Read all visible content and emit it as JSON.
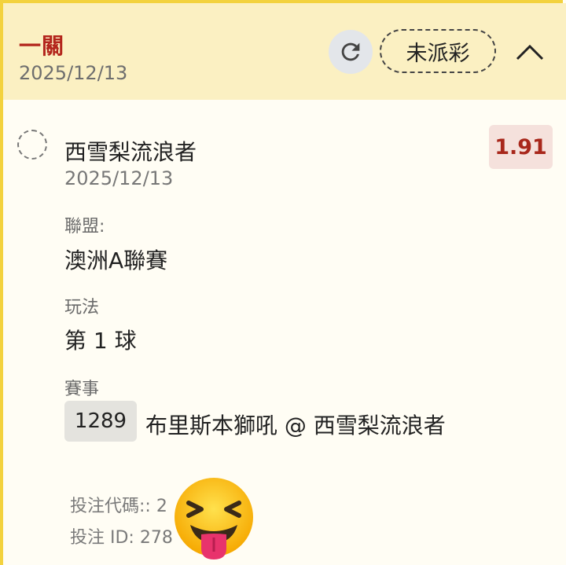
{
  "header": {
    "title": "一關",
    "date": "2025/12/13",
    "status_label": "未派彩"
  },
  "selection": {
    "team": "西雪梨流浪者",
    "odds": "1.91",
    "date": "2025/12/13",
    "league_label": "聯盟:",
    "league_value": "澳洲A聯賽",
    "play_label": "玩法",
    "play_value": "第 1 球",
    "match_label": "賽事",
    "match_id": "1289",
    "match_name": "布里斯本獅吼 @ 西雪梨流浪者"
  },
  "footer": {
    "bet_code": "投注代碼:: 2        49",
    "bet_id": "投注 ID: 278        .1"
  },
  "icons": {
    "refresh": "refresh-icon",
    "collapse": "chevron-up-icon",
    "overlay": "tongue-out-emoji"
  },
  "colors": {
    "accent_red": "#b3251c",
    "header_bg": "#fbf0c2",
    "border_yellow": "#f3d23e",
    "odds_bg": "#f5e1dc"
  }
}
